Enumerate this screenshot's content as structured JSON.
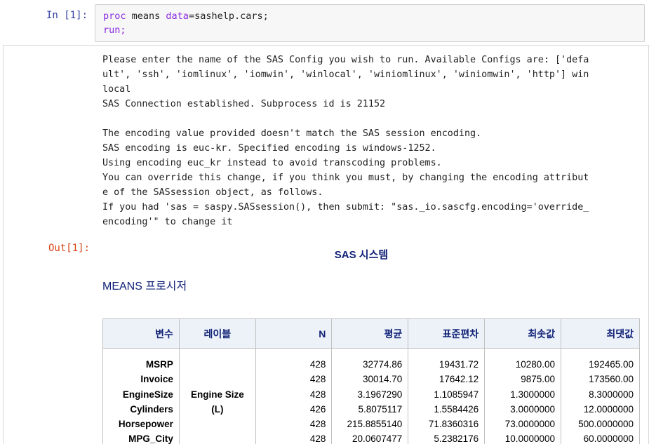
{
  "input_cell": {
    "prompt": "In [1]:",
    "code_lines": [
      [
        {
          "text": "proc",
          "kw": true
        },
        {
          "text": " means ",
          "kw": false
        },
        {
          "text": "data",
          "kw": true
        },
        {
          "text": "=sashelp.cars;",
          "kw": false
        }
      ],
      [
        {
          "text": "run;",
          "kw": true
        }
      ]
    ]
  },
  "stdout_lines": [
    "Please enter the name of the SAS Config you wish to run. Available Configs are: ['defa",
    "ult', 'ssh', 'iomlinux', 'iomwin', 'winlocal', 'winiomlinux', 'winiomwin', 'http'] win",
    "local",
    "SAS Connection established. Subprocess id is 21152",
    "",
    "The encoding value provided doesn't match the SAS session encoding.",
    "SAS encoding is euc-kr. Specified encoding is windows-1252.",
    "Using encoding euc_kr instead to avoid transcoding problems.",
    "You can override this change, if you think you must, by changing the encoding attribut",
    "e of the SASsession object, as follows.",
    "If you had 'sas = saspy.SASsession(), then submit: \"sas._io.sascfg.encoding='override_",
    "encoding'\" to change it"
  ],
  "output": {
    "prompt": "Out[1]:",
    "sas_title": "SAS 시스템",
    "proc_title": "MEANS 프로시저",
    "table": {
      "headers": [
        "변수",
        "레이블",
        "N",
        "평균",
        "표준편차",
        "최솟값",
        "최댓값"
      ],
      "variables": [
        "MSRP",
        "Invoice",
        "EngineSize",
        "Cylinders",
        "Horsepower",
        "MPG_City"
      ],
      "label_lines": [
        "",
        "",
        "Engine Size",
        "(L)",
        "",
        ""
      ],
      "n": [
        "428",
        "428",
        "428",
        "426",
        "428",
        "428"
      ],
      "mean": [
        "32774.86",
        "30014.70",
        "3.1967290",
        "5.8075117",
        "215.8855140",
        "20.0607477"
      ],
      "std": [
        "19431.72",
        "17642.12",
        "1.1085947",
        "1.5584426",
        "71.8360316",
        "5.2382176"
      ],
      "min": [
        "10280.00",
        "9875.00",
        "1.3000000",
        "3.0000000",
        "73.0000000",
        "10.0000000"
      ],
      "max": [
        "192465.00",
        "173560.00",
        "8.3000000",
        "12.0000000",
        "500.0000000",
        "60.0000000"
      ]
    }
  }
}
